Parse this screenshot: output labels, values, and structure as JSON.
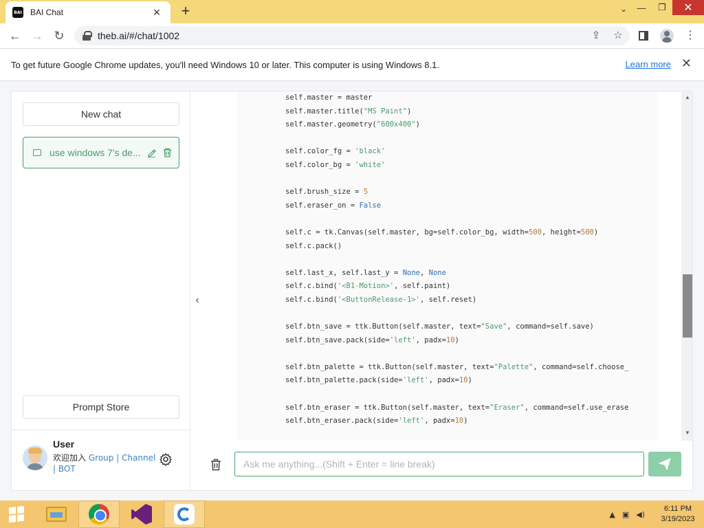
{
  "browser": {
    "tab_title": "BAI Chat",
    "favicon_text": "BAI",
    "url": "theb.ai/#/chat/1002",
    "infobar_text": "To get future Google Chrome updates, you'll need Windows 10 or later. This computer is using Windows 8.1.",
    "infobar_link": "Learn more"
  },
  "sidebar": {
    "new_chat": "New chat",
    "chats": [
      {
        "title": "use windows 7's de..."
      }
    ],
    "prompt_store": "Prompt Store",
    "user": {
      "name": "User",
      "join_text": "欢迎加入",
      "group": "Group",
      "channel": "Channel",
      "bot": "BOT",
      "separator": "|"
    }
  },
  "chat": {
    "code_lines": [
      "self.master = master",
      "self.master.title(\"MS Paint\")",
      "self.master.geometry(\"600x400\")",
      "",
      "self.color_fg = 'black'",
      "self.color_bg = 'white'",
      "",
      "self.brush_size = 5",
      "self.eraser_on = False",
      "",
      "self.c = tk.Canvas(self.master, bg=self.color_bg, width=500, height=500)",
      "self.c.pack()",
      "",
      "self.last_x, self.last_y = None, None",
      "self.c.bind('<B1-Motion>', self.paint)",
      "self.c.bind('<ButtonRelease-1>', self.reset)",
      "",
      "self.btn_save = ttk.Button(self.master, text=\"Save\", command=self.save)",
      "self.btn_save.pack(side='left', padx=10)",
      "",
      "self.btn_palette = ttk.Button(self.master, text=\"Palette\", command=self.choose_",
      "self.btn_palette.pack(side='left', padx=10)",
      "",
      "self.btn_eraser = ttk.Button(self.master, text=\"Eraser\", command=self.use_erase",
      "self.btn_eraser.pack(side='left', padx=10)"
    ],
    "input_placeholder": "Ask me anything...(Shift + Enter = line break)",
    "input_value": ""
  },
  "taskbar": {
    "time": "6:11 PM",
    "date": "3/19/2023"
  },
  "colors": {
    "accent_green": "#4ca36e",
    "tab_strip": "#f5d87a",
    "taskbar": "#f3c66f"
  }
}
